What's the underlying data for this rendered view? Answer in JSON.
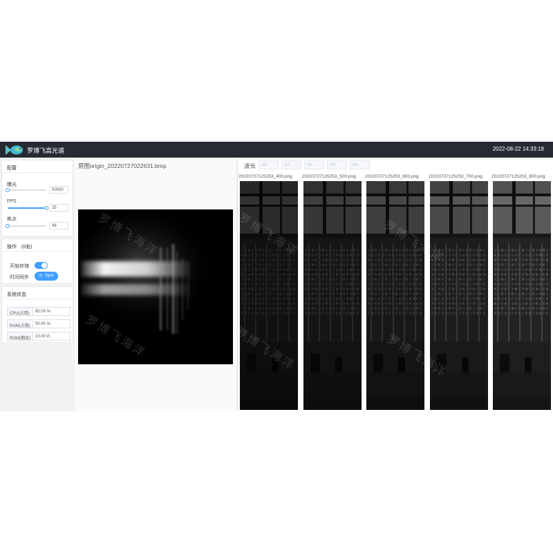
{
  "header": {
    "app_title": "罗博飞高光谱",
    "datetime": "2022-08-22 14:33:18"
  },
  "config": {
    "title": "配置",
    "exposure": {
      "label": "曝光",
      "value": "50000",
      "level": 0.0
    },
    "fps": {
      "label": "FPS",
      "value": "25",
      "level": 1.0
    },
    "focus": {
      "label": "焦点",
      "value": "48",
      "level": 0.0
    }
  },
  "operations": {
    "title": "操作",
    "count": "(0张)",
    "save_label": "开始存储",
    "save_enabled": true,
    "sync_label": "时间同步",
    "sync_button": "Sync"
  },
  "system_status": {
    "title": "系统状态",
    "rows": [
      {
        "key": "CPU(占用)",
        "value": "80.00 %"
      },
      {
        "key": "RAM(占用)",
        "value": "50.00 %"
      },
      {
        "key": "ROM(剩余)",
        "value": "10.00 G"
      }
    ]
  },
  "origin": {
    "title": "原图origin_20220727022631.bmp"
  },
  "wavelength": {
    "label": "波长",
    "inputs": [
      "400",
      "500",
      "600",
      "700",
      "800"
    ]
  },
  "band_images": [
    {
      "filename": "20220727125253_400.png",
      "brightness": 0.55
    },
    {
      "filename": "20220727125253_500.png",
      "brightness": 0.7
    },
    {
      "filename": "20220727125253_600.png",
      "brightness": 0.8
    },
    {
      "filename": "20220727125253_700.png",
      "brightness": 0.95
    },
    {
      "filename": "20220727125253_800.png",
      "brightness": 1.15
    }
  ],
  "watermark": "罗博飞海洋",
  "colors": {
    "header_bg": "#262b33",
    "accent": "#409eff"
  }
}
